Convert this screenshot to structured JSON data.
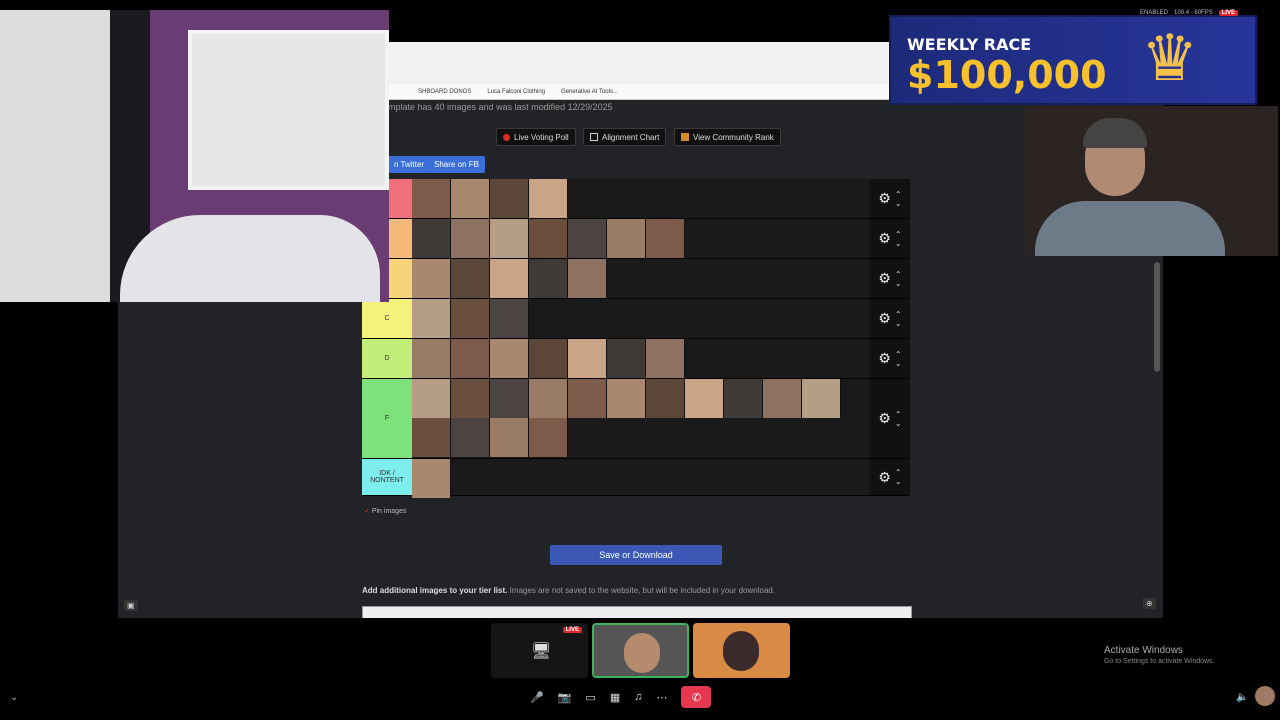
{
  "screen": {
    "bookmarks": [
      "SHBOARD DONOS",
      "Luca Falconi Clothing",
      "Generative AI Tools..."
    ],
    "template_note": "mplate has 40 images and was last modified 12/29/2025",
    "buttons": {
      "live_voting": "Live Voting Poll",
      "alignment": "Alignment Chart",
      "community": "View Community Rank"
    },
    "share": {
      "twitter": "n Twitter",
      "facebook": "Share on FB"
    },
    "tiers": [
      {
        "label": "",
        "color": "#ef6f7a",
        "count": 4
      },
      {
        "label": "",
        "color": "#f4b879",
        "count": 7
      },
      {
        "label": "",
        "color": "#f6d57a",
        "count": 5
      },
      {
        "label": "C",
        "color": "#f4f27a",
        "count": 3
      },
      {
        "label": "D",
        "color": "#c4ee7a",
        "count": 7
      },
      {
        "label": "F",
        "color": "#7ee27a",
        "count": 15
      },
      {
        "label": "IDK / NONTENT",
        "color": "#7eeded",
        "count": 1
      }
    ],
    "pin_label": "Pin images",
    "save_label": "Save or Download",
    "add_note_bold": "Add additional images to your tier list.",
    "add_note_rest": " Images are not saved to the website, but will be included in your download."
  },
  "banner": {
    "title": "WEEKLY RACE",
    "amount": "$100,000"
  },
  "status": {
    "left": "ENABLED",
    "right": "100.4 · 60FPS",
    "live": "LIVE"
  },
  "call": {
    "live_badge": "LIVE",
    "activate_title": "Activate Windows",
    "activate_sub": "Go to Settings to activate Windows."
  },
  "thumb_colors": [
    "#7d5a4a",
    "#a8896f",
    "#5c4637",
    "#c9a487",
    "#3f3a36",
    "#8e7261",
    "#b69d85",
    "#6b4f3e",
    "#4c4441",
    "#9a7c66"
  ]
}
